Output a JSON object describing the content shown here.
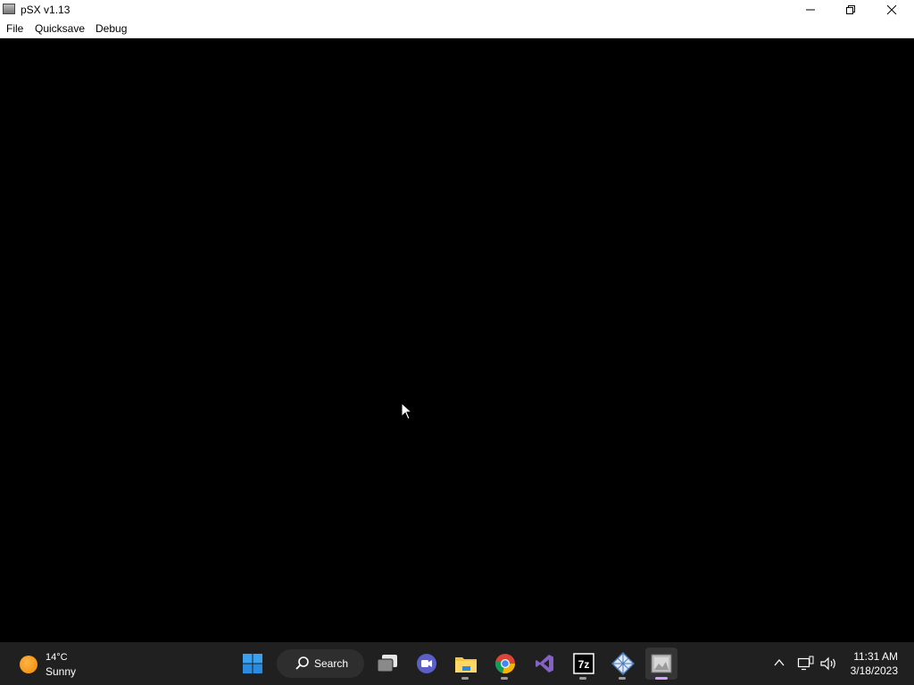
{
  "window": {
    "title": "pSX v1.13",
    "icon": "app-window-icon",
    "controls": [
      "minimize-icon",
      "maximize-icon",
      "close-icon"
    ]
  },
  "menu": {
    "items": [
      {
        "label": "File"
      },
      {
        "label": "Quicksave"
      },
      {
        "label": "Debug"
      }
    ]
  },
  "taskbar": {
    "weather": {
      "temperature": "14°C",
      "condition": "Sunny",
      "icon": "sun-icon"
    },
    "search_label": "Search",
    "apps": [
      {
        "name": "task-view"
      },
      {
        "name": "teams"
      },
      {
        "name": "file-explorer"
      },
      {
        "name": "chrome"
      },
      {
        "name": "visual-studio"
      },
      {
        "name": "7-zip",
        "label": "7z"
      },
      {
        "name": "app"
      },
      {
        "name": "psx"
      }
    ],
    "clock": {
      "time": "11:31 AM",
      "date": "3/18/2023"
    }
  },
  "colors": {
    "taskbar_bg": "#202020",
    "game_bg": "#000000",
    "active_indicator": "#d9a0ff"
  }
}
